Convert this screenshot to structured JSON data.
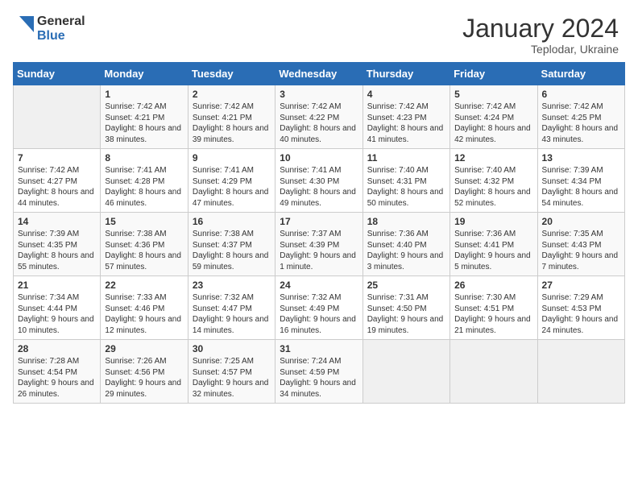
{
  "header": {
    "logo_general": "General",
    "logo_blue": "Blue",
    "month_year": "January 2024",
    "location": "Teplodar, Ukraine"
  },
  "weekdays": [
    "Sunday",
    "Monday",
    "Tuesday",
    "Wednesday",
    "Thursday",
    "Friday",
    "Saturday"
  ],
  "weeks": [
    [
      {
        "day": "",
        "sunrise": "",
        "sunset": "",
        "daylight": ""
      },
      {
        "day": "1",
        "sunrise": "Sunrise: 7:42 AM",
        "sunset": "Sunset: 4:21 PM",
        "daylight": "Daylight: 8 hours and 38 minutes."
      },
      {
        "day": "2",
        "sunrise": "Sunrise: 7:42 AM",
        "sunset": "Sunset: 4:21 PM",
        "daylight": "Daylight: 8 hours and 39 minutes."
      },
      {
        "day": "3",
        "sunrise": "Sunrise: 7:42 AM",
        "sunset": "Sunset: 4:22 PM",
        "daylight": "Daylight: 8 hours and 40 minutes."
      },
      {
        "day": "4",
        "sunrise": "Sunrise: 7:42 AM",
        "sunset": "Sunset: 4:23 PM",
        "daylight": "Daylight: 8 hours and 41 minutes."
      },
      {
        "day": "5",
        "sunrise": "Sunrise: 7:42 AM",
        "sunset": "Sunset: 4:24 PM",
        "daylight": "Daylight: 8 hours and 42 minutes."
      },
      {
        "day": "6",
        "sunrise": "Sunrise: 7:42 AM",
        "sunset": "Sunset: 4:25 PM",
        "daylight": "Daylight: 8 hours and 43 minutes."
      }
    ],
    [
      {
        "day": "7",
        "sunrise": "Sunrise: 7:42 AM",
        "sunset": "Sunset: 4:27 PM",
        "daylight": "Daylight: 8 hours and 44 minutes."
      },
      {
        "day": "8",
        "sunrise": "Sunrise: 7:41 AM",
        "sunset": "Sunset: 4:28 PM",
        "daylight": "Daylight: 8 hours and 46 minutes."
      },
      {
        "day": "9",
        "sunrise": "Sunrise: 7:41 AM",
        "sunset": "Sunset: 4:29 PM",
        "daylight": "Daylight: 8 hours and 47 minutes."
      },
      {
        "day": "10",
        "sunrise": "Sunrise: 7:41 AM",
        "sunset": "Sunset: 4:30 PM",
        "daylight": "Daylight: 8 hours and 49 minutes."
      },
      {
        "day": "11",
        "sunrise": "Sunrise: 7:40 AM",
        "sunset": "Sunset: 4:31 PM",
        "daylight": "Daylight: 8 hours and 50 minutes."
      },
      {
        "day": "12",
        "sunrise": "Sunrise: 7:40 AM",
        "sunset": "Sunset: 4:32 PM",
        "daylight": "Daylight: 8 hours and 52 minutes."
      },
      {
        "day": "13",
        "sunrise": "Sunrise: 7:39 AM",
        "sunset": "Sunset: 4:34 PM",
        "daylight": "Daylight: 8 hours and 54 minutes."
      }
    ],
    [
      {
        "day": "14",
        "sunrise": "Sunrise: 7:39 AM",
        "sunset": "Sunset: 4:35 PM",
        "daylight": "Daylight: 8 hours and 55 minutes."
      },
      {
        "day": "15",
        "sunrise": "Sunrise: 7:38 AM",
        "sunset": "Sunset: 4:36 PM",
        "daylight": "Daylight: 8 hours and 57 minutes."
      },
      {
        "day": "16",
        "sunrise": "Sunrise: 7:38 AM",
        "sunset": "Sunset: 4:37 PM",
        "daylight": "Daylight: 8 hours and 59 minutes."
      },
      {
        "day": "17",
        "sunrise": "Sunrise: 7:37 AM",
        "sunset": "Sunset: 4:39 PM",
        "daylight": "Daylight: 9 hours and 1 minute."
      },
      {
        "day": "18",
        "sunrise": "Sunrise: 7:36 AM",
        "sunset": "Sunset: 4:40 PM",
        "daylight": "Daylight: 9 hours and 3 minutes."
      },
      {
        "day": "19",
        "sunrise": "Sunrise: 7:36 AM",
        "sunset": "Sunset: 4:41 PM",
        "daylight": "Daylight: 9 hours and 5 minutes."
      },
      {
        "day": "20",
        "sunrise": "Sunrise: 7:35 AM",
        "sunset": "Sunset: 4:43 PM",
        "daylight": "Daylight: 9 hours and 7 minutes."
      }
    ],
    [
      {
        "day": "21",
        "sunrise": "Sunrise: 7:34 AM",
        "sunset": "Sunset: 4:44 PM",
        "daylight": "Daylight: 9 hours and 10 minutes."
      },
      {
        "day": "22",
        "sunrise": "Sunrise: 7:33 AM",
        "sunset": "Sunset: 4:46 PM",
        "daylight": "Daylight: 9 hours and 12 minutes."
      },
      {
        "day": "23",
        "sunrise": "Sunrise: 7:32 AM",
        "sunset": "Sunset: 4:47 PM",
        "daylight": "Daylight: 9 hours and 14 minutes."
      },
      {
        "day": "24",
        "sunrise": "Sunrise: 7:32 AM",
        "sunset": "Sunset: 4:49 PM",
        "daylight": "Daylight: 9 hours and 16 minutes."
      },
      {
        "day": "25",
        "sunrise": "Sunrise: 7:31 AM",
        "sunset": "Sunset: 4:50 PM",
        "daylight": "Daylight: 9 hours and 19 minutes."
      },
      {
        "day": "26",
        "sunrise": "Sunrise: 7:30 AM",
        "sunset": "Sunset: 4:51 PM",
        "daylight": "Daylight: 9 hours and 21 minutes."
      },
      {
        "day": "27",
        "sunrise": "Sunrise: 7:29 AM",
        "sunset": "Sunset: 4:53 PM",
        "daylight": "Daylight: 9 hours and 24 minutes."
      }
    ],
    [
      {
        "day": "28",
        "sunrise": "Sunrise: 7:28 AM",
        "sunset": "Sunset: 4:54 PM",
        "daylight": "Daylight: 9 hours and 26 minutes."
      },
      {
        "day": "29",
        "sunrise": "Sunrise: 7:26 AM",
        "sunset": "Sunset: 4:56 PM",
        "daylight": "Daylight: 9 hours and 29 minutes."
      },
      {
        "day": "30",
        "sunrise": "Sunrise: 7:25 AM",
        "sunset": "Sunset: 4:57 PM",
        "daylight": "Daylight: 9 hours and 32 minutes."
      },
      {
        "day": "31",
        "sunrise": "Sunrise: 7:24 AM",
        "sunset": "Sunset: 4:59 PM",
        "daylight": "Daylight: 9 hours and 34 minutes."
      },
      {
        "day": "",
        "sunrise": "",
        "sunset": "",
        "daylight": ""
      },
      {
        "day": "",
        "sunrise": "",
        "sunset": "",
        "daylight": ""
      },
      {
        "day": "",
        "sunrise": "",
        "sunset": "",
        "daylight": ""
      }
    ]
  ]
}
